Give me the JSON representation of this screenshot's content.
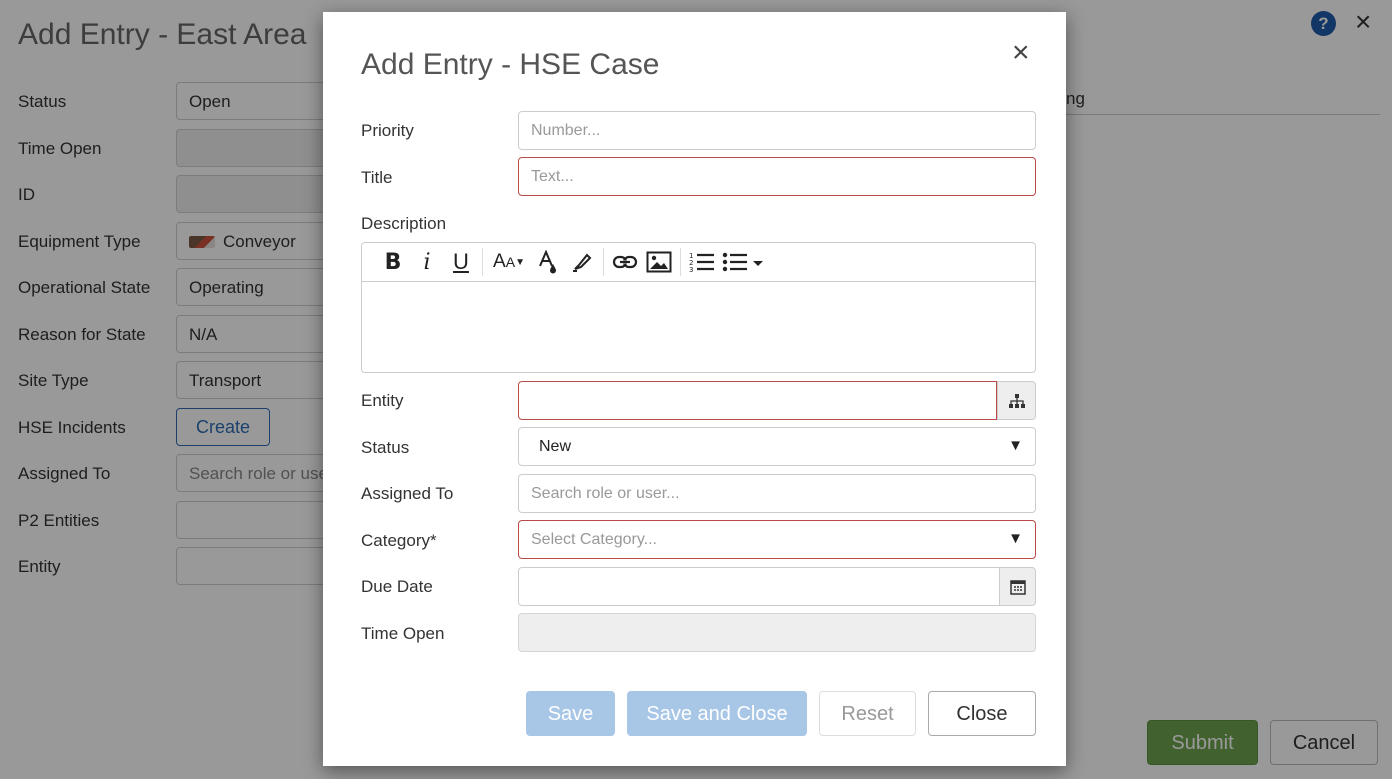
{
  "background": {
    "title": "Add Entry - East Area",
    "fields": [
      {
        "label": "Status",
        "value": "Open"
      },
      {
        "label": "Time Open",
        "value": ""
      },
      {
        "label": "ID",
        "value": ""
      },
      {
        "label": "Equipment Type",
        "value": "Conveyor"
      },
      {
        "label": "Operational State",
        "value": "Operating"
      },
      {
        "label": "Reason for State",
        "value": "N/A"
      },
      {
        "label": "Site Type",
        "value": "Transport"
      },
      {
        "label": "HSE Incidents",
        "value": "Create"
      },
      {
        "label": "Assigned To",
        "placeholder": "Search role or user..."
      },
      {
        "label": "P2 Entities",
        "value": ""
      },
      {
        "label": "Entity",
        "value": ""
      }
    ],
    "right_partial_text": "ng",
    "help_icon": "?",
    "submit_label": "Submit",
    "cancel_label": "Cancel"
  },
  "modal": {
    "title": "Add Entry - HSE Case",
    "close_glyph": "×",
    "priority": {
      "label": "Priority",
      "placeholder": "Number..."
    },
    "title_field": {
      "label": "Title",
      "placeholder": "Text..."
    },
    "description": {
      "label": "Description"
    },
    "entity": {
      "label": "Entity",
      "value": ""
    },
    "status": {
      "label": "Status",
      "value": "New"
    },
    "assigned_to": {
      "label": "Assigned To",
      "placeholder": "Search role or user..."
    },
    "category": {
      "label": "Category*",
      "placeholder": "Select Category..."
    },
    "due_date": {
      "label": "Due Date",
      "value": ""
    },
    "time_open": {
      "label": "Time Open",
      "value": ""
    },
    "buttons": {
      "save": "Save",
      "save_and_close": "Save and Close",
      "reset": "Reset",
      "close": "Close"
    },
    "toolbar_icons": [
      "bold-icon",
      "italic-icon",
      "underline-icon",
      "font-size-icon",
      "font-color-icon",
      "highlighter-icon",
      "link-icon",
      "image-icon",
      "ordered-list-icon",
      "unordered-list-icon"
    ],
    "error_color": "#b94a48",
    "primary_disabled_color": "#a8c6e6"
  }
}
